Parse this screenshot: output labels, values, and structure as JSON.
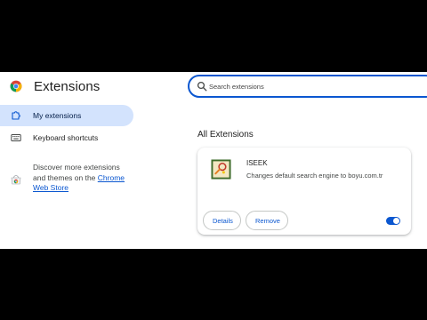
{
  "header": {
    "title": "Extensions",
    "search_placeholder": "Search extensions"
  },
  "sidebar": {
    "items": [
      {
        "label": "My extensions",
        "icon": "puzzle-icon",
        "active": true
      },
      {
        "label": "Keyboard shortcuts",
        "icon": "keyboard-icon",
        "active": false
      }
    ],
    "discover_text": "Discover more extensions and themes on the ",
    "discover_link": "Chrome Web Store"
  },
  "main": {
    "section_title": "All Extensions",
    "extension": {
      "name": "ISEEK",
      "description": "Changes default search engine to boyu.com.tr",
      "details_label": "Details",
      "remove_label": "Remove",
      "enabled": true
    }
  },
  "colors": {
    "accent": "#0b57d0",
    "active_nav_bg": "#d3e3fd"
  }
}
